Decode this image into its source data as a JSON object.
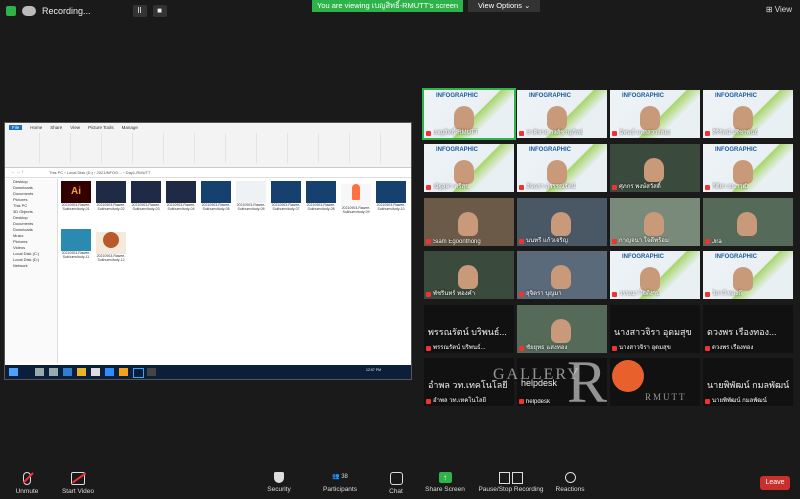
{
  "top_bar": {
    "recording_label": "Recording...",
    "viewing_banner": "You are viewing เบญสิทธิ์-RMUTT's screen",
    "view_options": "View Options",
    "view_button": "View",
    "pause_glyph": "II",
    "stop_glyph": "■"
  },
  "explorer": {
    "tabs": [
      "File",
      "Home",
      "Share",
      "View",
      "Picture Tools",
      "Manage"
    ],
    "breadcrumb": "This PC › Local Disk (D:) › 2021INFOG… › Day1-RMUTT",
    "nav_items": [
      "Desktop",
      "Downloads",
      "Documents",
      "Pictures",
      "This PC",
      "3D Objects",
      "Desktop",
      "Documents",
      "Downloads",
      "Music",
      "Pictures",
      "Videos",
      "Local Disk (C:)",
      "Local Disk (D:)",
      "Network"
    ],
    "files": [
      {
        "label": "20210903-Rawee-Sukhumvitudy-01",
        "kind": "ai"
      },
      {
        "label": "20210903-Rawee-Sukhumvitudy-02",
        "kind": "dark"
      },
      {
        "label": "20210903-Rawee-Sukhumvitudy-03",
        "kind": "dark"
      },
      {
        "label": "20210903-Rawee-Sukhumvitudy-04",
        "kind": "dark"
      },
      {
        "label": "20210903-Rawee-Sukhumvitudy-05",
        "kind": "blue"
      },
      {
        "label": "20210903-Rawee-Sukhumvitudy-06",
        "kind": "white"
      },
      {
        "label": "20210903-Rawee-Sukhumvitudy-07",
        "kind": "blue"
      },
      {
        "label": "20210903-Rawee-Sukhumvitudy-08",
        "kind": "blue"
      },
      {
        "label": "20210903-Rawee-Sukhumvitudy-09",
        "kind": "rocket"
      },
      {
        "label": "20210903-Rawee-Sukhumvitudy-10",
        "kind": "blue"
      },
      {
        "label": "20210903-Rawee-Sukhumvitudy-11",
        "kind": "teal"
      },
      {
        "label": "20210903-Rawee-Sukhumvitudy-12",
        "kind": "seal"
      }
    ],
    "ai_glyph": "Ai",
    "tray_time": "12:57 PM"
  },
  "gallery": {
    "tiles": [
      {
        "name": "เบญสิทธิ์-RMUTT",
        "kind": "infographic",
        "active": true
      },
      {
        "name": "ชาติชาย วงศ์ชาญวิทย์",
        "kind": "infographic"
      },
      {
        "name": "นิพนธ์ แสงสว่างทอง",
        "kind": "infographic"
      },
      {
        "name": "ศิริรัตน์ ปรีชาพันธ์",
        "kind": "infographic"
      },
      {
        "name": "ณัฐสุดา ศรีสุข",
        "kind": "infographic"
      },
      {
        "name": "อัจฉรา สุวรรณรัตน์",
        "kind": "infographic"
      },
      {
        "name": "ศุภกร พงษ์สวัสดิ์",
        "kind": "camera"
      },
      {
        "name": "กิติยา ธนาวุฒิ",
        "kind": "infographic"
      },
      {
        "name": "Siam Egoonthong",
        "kind": "camera"
      },
      {
        "name": "นนทรี แก้วเจริญ",
        "kind": "camera"
      },
      {
        "name": "กาญจนา ใจดีพร้อม",
        "kind": "camera"
      },
      {
        "name": "Jira",
        "kind": "camera"
      },
      {
        "name": "พัชรินทร์ ทองคำ",
        "kind": "camera"
      },
      {
        "name": "สุจิตรา บุญมา",
        "kind": "camera"
      },
      {
        "name": "วรรณา ใจดีงาม",
        "kind": "infographic"
      },
      {
        "name": "วิภาวี ทองดี",
        "kind": "infographic"
      },
      {
        "name": "พรรณรัตน์ บริพนธ์...",
        "kind": "black",
        "big": "พรรณรัตน์ บริพนธ์..."
      },
      {
        "name": "ชัยยุทธ แสงทอง",
        "kind": "camera"
      },
      {
        "name": "นางสาวจิรา อุดมสุข",
        "kind": "black",
        "big": "นางสาวจิรา อุดมสุข"
      },
      {
        "name": "ดวงพร เรืองทอง",
        "kind": "black",
        "big": "ดวงพร เรืองทอง..."
      },
      {
        "name": "อำพล วท.เทคโนโลยี",
        "kind": "black",
        "big": "อำพล วท.เทคโนโลยี"
      },
      {
        "name": "helpdesk",
        "kind": "black",
        "big": "helpdesk"
      },
      {
        "name": "",
        "kind": "black",
        "big": ""
      },
      {
        "name": "นายพิพัฒน์ กมลพัฒน์",
        "kind": "black",
        "big": "นายพิพัฒน์ กมลพัฒน์"
      }
    ],
    "infographic_title": "INFOGRAPHIC"
  },
  "watermark": {
    "word": "GALLERY",
    "letter": "R",
    "sub": "RMUTT"
  },
  "toolbar": {
    "unmute": "Unmute",
    "start_video": "Start Video",
    "security": "Security",
    "participants": "Participants",
    "participants_count": "38",
    "chat": "Chat",
    "share_screen": "Share Screen",
    "recording": "Pause/Stop Recording",
    "reactions": "Reactions",
    "leave": "Leave"
  },
  "colors": {
    "zoom_green": "#2db34a",
    "leave_red": "#c9302c",
    "taskbar": "#0c1f3a"
  }
}
